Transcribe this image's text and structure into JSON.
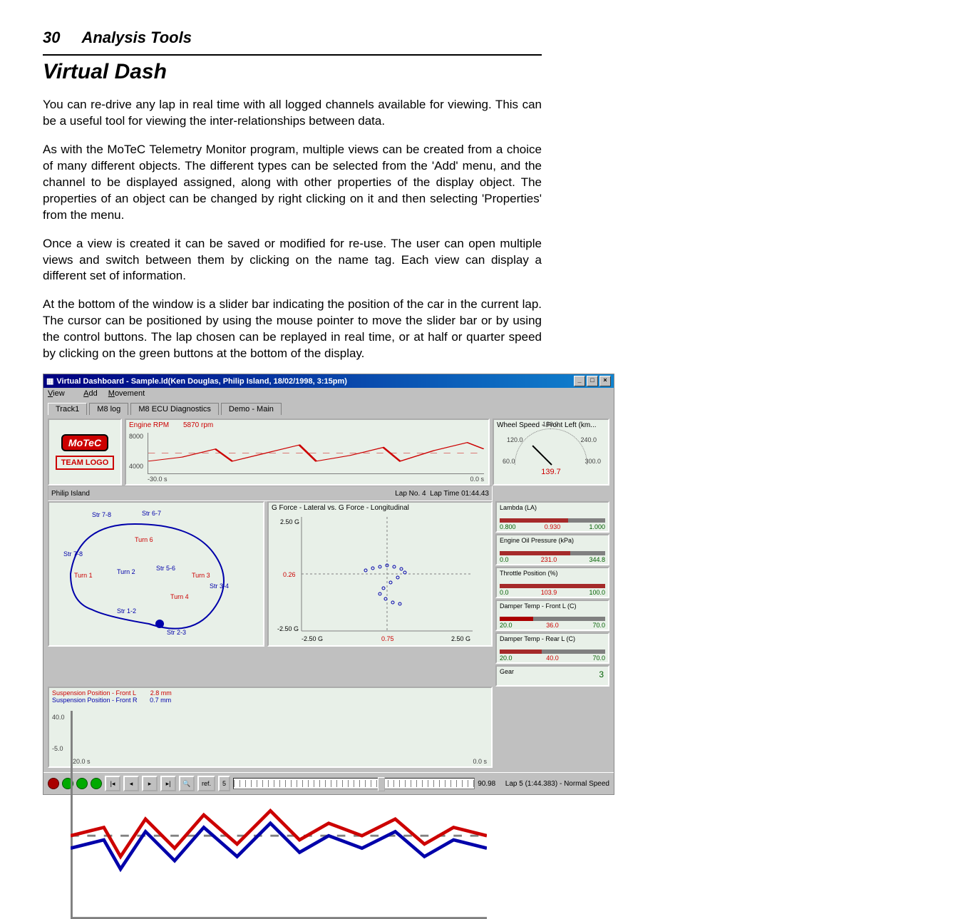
{
  "header": {
    "page_number": "30",
    "section": "Analysis Tools"
  },
  "title": "Virtual Dash",
  "paragraphs": [
    "You can re-drive any lap in real time with all logged channels available for viewing. This can be a useful tool for viewing the inter-relationships between data.",
    "As with the MoTeC Telemetry Monitor program, multiple views can be created from a choice of many different objects. The different types can be selected from the 'Add' menu, and the channel to be displayed assigned, along with other properties of the display object. The properties of an object can be changed by right clicking on it and then selecting 'Properties' from the menu.",
    "Once a view is created it can be saved or modified for re-use. The user can open multiple views and switch between them by clicking on the name tag. Each view can display a different set of information.",
    "At the bottom of the window is a slider bar indicating the position of the car in the current lap. The cursor can be positioned by using the mouse pointer to move the slider bar or by using the control buttons. The lap chosen can be replayed in real time, or at half or quarter speed by clicking on the green buttons at the bottom of the display."
  ],
  "window": {
    "title": "Virtual Dashboard - Sample.ld(Ken Douglas, Philip Island, 18/02/1998,  3:15pm)",
    "menu": {
      "view": "View",
      "add": "Add",
      "movement": "Movement"
    },
    "tabs": [
      "Track1",
      "M8 log",
      "M8 ECU Diagnostics",
      "Demo - Main"
    ],
    "logos": {
      "motec": "MoTeC",
      "team": "TEAM LOGO"
    },
    "rpm": {
      "label": "Engine RPM",
      "value": "5870 rpm",
      "y_hi": "8000",
      "y_lo": "4000",
      "x_lo": "-30.0 s",
      "x_hi": "0.0 s"
    },
    "speed": {
      "title": "Wheel Speed - Front Left (km...",
      "ticks": {
        "t60": "60.0",
        "t120": "120.0",
        "t180": "180.0",
        "t240": "240.0",
        "t300": "300.0"
      },
      "value": "139.7"
    },
    "trackrow": {
      "name": "Philip Island",
      "lapno_lbl": "Lap No.",
      "lapno": "4",
      "laptime_lbl": "Lap Time",
      "laptime": "01:44.43"
    },
    "map_labels": {
      "s78": "Str 7-8",
      "s67": "Str 6-7",
      "t6": "Turn 6",
      "s7b": "Str 7-8",
      "t1": "Turn 1",
      "t2": "Turn 2",
      "s56": "Str 5-6",
      "t3": "Turn 3",
      "s34": "Str 3-4",
      "t4": "Turn 4",
      "s12": "Str 1-2",
      "s23": "Str 2-3"
    },
    "gforce": {
      "title": "G Force - Lateral vs. G Force - Longitudinal",
      "y_hi": "2.50 G",
      "y_mid": "0.26",
      "y_lo": "-2.50 G",
      "x_lo": "-2.50 G",
      "x_mid": "0.75",
      "x_hi": "2.50 G"
    },
    "side": {
      "lambda": {
        "title": "Lambda (LA)",
        "lo": "0.800",
        "mid": "0.930",
        "hi": "1.000"
      },
      "oil": {
        "title": "Engine Oil Pressure (kPa)",
        "lo": "0.0",
        "mid": "231.0",
        "hi": "344.8"
      },
      "thr": {
        "title": "Throttle Position (%)",
        "lo": "0.0",
        "mid": "103.9",
        "hi": "100.0"
      },
      "dfl": {
        "title": "Damper Temp - Front L (C)",
        "lo": "20.0",
        "mid": "36.0",
        "hi": "70.0"
      },
      "drl": {
        "title": "Damper Temp - Rear L (C)",
        "lo": "20.0",
        "mid": "40.0",
        "hi": "70.0"
      },
      "gear": {
        "title": "Gear",
        "value": "3"
      }
    },
    "susp": {
      "l_label": "Suspension Position - Front L",
      "l_val": "2.8 mm",
      "r_label": "Suspension Position - Front R",
      "r_val": "0.7 mm",
      "y_hi": "40.0",
      "y_lo": "-5.0",
      "x_lo": "-20.0 s",
      "x_hi": "0.0 s"
    },
    "slider": {
      "ref": "ref.",
      "step": "5",
      "time": "90.98",
      "status": "Lap 5 (1:44.383) - Normal Speed"
    }
  }
}
